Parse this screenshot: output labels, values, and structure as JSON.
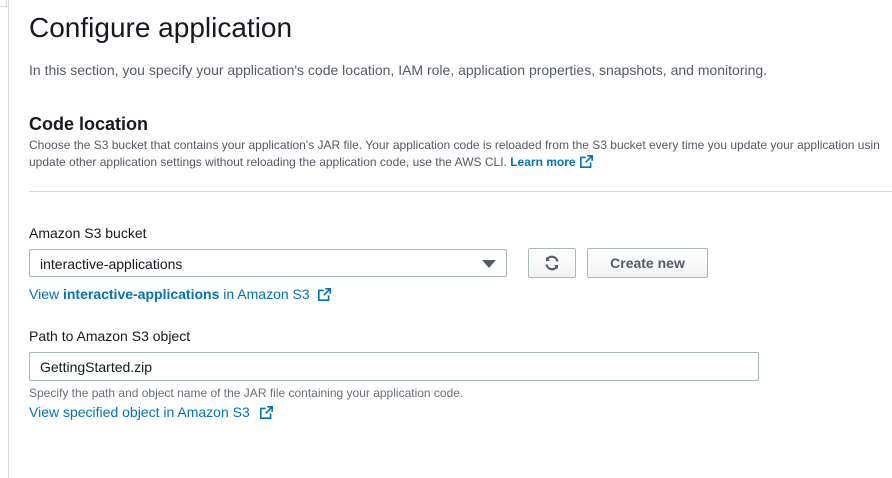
{
  "page": {
    "title": "Configure application",
    "description": "In this section, you specify your application's code location, IAM role, application properties, snapshots, and monitoring."
  },
  "code_location": {
    "title": "Code location",
    "description_line1": "Choose the S3 bucket that contains your application's JAR file. Your application code is reloaded from the S3 bucket every time you update your application usin",
    "description_line2": "update other application settings without reloading the application code, use the AWS CLI.",
    "learn_more": "Learn more"
  },
  "s3_bucket": {
    "label": "Amazon S3 bucket",
    "selected": "interactive-applications",
    "refresh_icon": "refresh-icon",
    "create_new_label": "Create new",
    "view_link_prefix": "View ",
    "view_link_bucket": "interactive-applications",
    "view_link_suffix": " in Amazon S3"
  },
  "s3_object": {
    "label": "Path to Amazon S3 object",
    "value": "GettingStarted.zip",
    "hint": "Specify the path and object name of the JAR file containing your application code.",
    "view_link": "View specified object in Amazon S3"
  },
  "colors": {
    "link": "#0073bb",
    "text": "#16191f",
    "secondary_text": "#545b64",
    "border": "#aab7b8",
    "divider": "#d5dbdb"
  }
}
